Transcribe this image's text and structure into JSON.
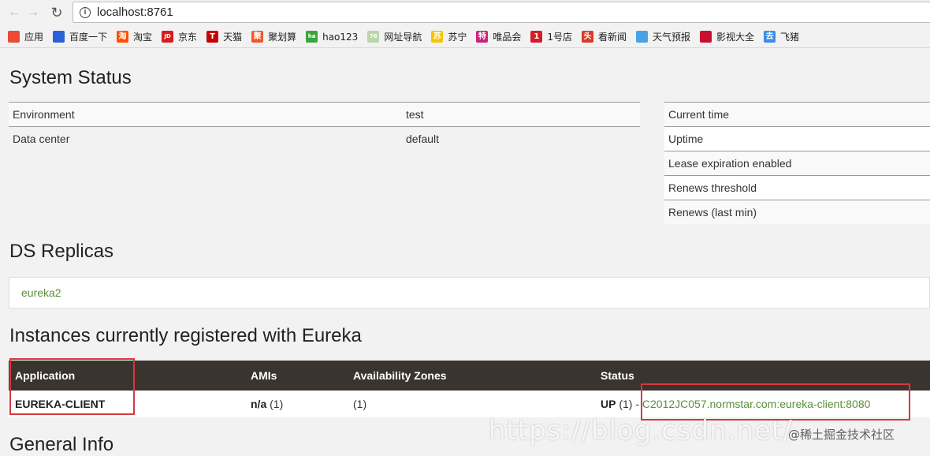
{
  "browser": {
    "url_host": "localhost",
    "url_port": ":8761",
    "bookmarks": [
      {
        "label": "应用",
        "icon": "apps-grid-icon",
        "color": "#e94b35"
      },
      {
        "label": "百度一下",
        "icon": "baidu-paw-icon",
        "color": "#2a62d9"
      },
      {
        "label": "淘宝",
        "icon": "taobao-icon",
        "color": "#ff5000"
      },
      {
        "label": "京东",
        "icon": "jd-icon",
        "color": "#d41d1d"
      },
      {
        "label": "天猫",
        "icon": "tmall-icon",
        "color": "#c40000"
      },
      {
        "label": "聚划算",
        "icon": "juhuasuan-icon",
        "color": "#f0572a"
      },
      {
        "label": "hao123",
        "icon": "hao123-icon",
        "color": "#3aa63a"
      },
      {
        "label": "网址导航",
        "icon": "7654-icon",
        "color": "#b7d7a8"
      },
      {
        "label": "苏宁",
        "icon": "suning-icon",
        "color": "#f5c400"
      },
      {
        "label": "唯品会",
        "icon": "vip-icon",
        "color": "#d21f7b"
      },
      {
        "label": "1号店",
        "icon": "yhd-icon",
        "color": "#d21f26"
      },
      {
        "label": "看新闻",
        "icon": "news-icon",
        "color": "#d83a2a"
      },
      {
        "label": "天气预报",
        "icon": "weather-icon",
        "color": "#47a3e6"
      },
      {
        "label": "影视大全",
        "icon": "video-play-icon",
        "color": "#c8102e"
      },
      {
        "label": "飞猪",
        "icon": "fliggy-icon",
        "color": "#3a8ee6"
      }
    ],
    "bookmark_glyphs": [
      "",
      "",
      "淘",
      "JD",
      "T",
      "聚",
      "hao",
      "7654",
      "苏",
      "特",
      "1",
      "头",
      "",
      "",
      "去"
    ]
  },
  "system_status": {
    "title": "System Status",
    "left": [
      {
        "key": "Environment",
        "value": "test"
      },
      {
        "key": "Data center",
        "value": "default"
      }
    ],
    "right": [
      "Current time",
      "Uptime",
      "Lease expiration enabled",
      "Renews threshold",
      "Renews (last min)"
    ]
  },
  "replicas": {
    "title": "DS Replicas",
    "items": [
      "eureka2"
    ]
  },
  "instances": {
    "title": "Instances currently registered with Eureka",
    "headers": [
      "Application",
      "AMIs",
      "Availability Zones",
      "Status"
    ],
    "rows": [
      {
        "application": "EUREKA-CLIENT",
        "amis": "n/a",
        "amis_count": "(1)",
        "zones": "(1)",
        "status": "UP",
        "status_count": "(1) -",
        "instance_link": "C2012JC057.normstar.com:eureka-client:8080"
      }
    ]
  },
  "general_info": {
    "title": "General Info"
  },
  "watermark": {
    "url": "https://blog.csdn.net/",
    "credit": "@稀土掘金技术社区"
  },
  "colors": {
    "link": "#5a8f3a",
    "table_header_bg": "#3a342f",
    "highlight_box": "#d9363e"
  }
}
